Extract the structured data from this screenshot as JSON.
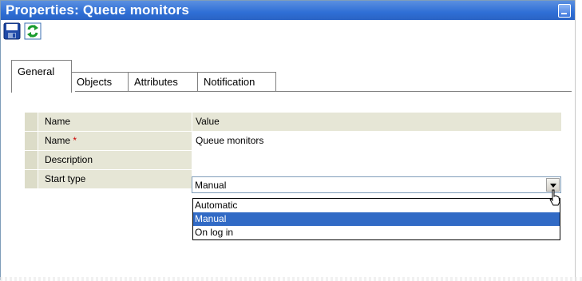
{
  "window": {
    "title": "Properties: Queue monitors"
  },
  "toolbar": {
    "save_icon": "save-icon",
    "refresh_icon": "refresh-icon"
  },
  "tabs": [
    {
      "label": "General",
      "active": true
    },
    {
      "label": "Objects",
      "active": false
    },
    {
      "label": "Attributes",
      "active": false
    },
    {
      "label": "Notification",
      "active": false
    }
  ],
  "grid": {
    "columns": [
      "Name",
      "Value"
    ],
    "rows": [
      {
        "name": "Name",
        "required_marker": "*",
        "value": "Queue monitors"
      },
      {
        "name": "Description",
        "required_marker": "",
        "value": ""
      },
      {
        "name": "Start type",
        "required_marker": "",
        "value": "Manual"
      }
    ]
  },
  "start_type_dropdown": {
    "selected": "Manual",
    "options": [
      "Automatic",
      "Manual",
      "On log in"
    ]
  },
  "colors": {
    "titlebar": "#2f6fd6",
    "selection": "#316ac5",
    "required": "#cc0000"
  }
}
